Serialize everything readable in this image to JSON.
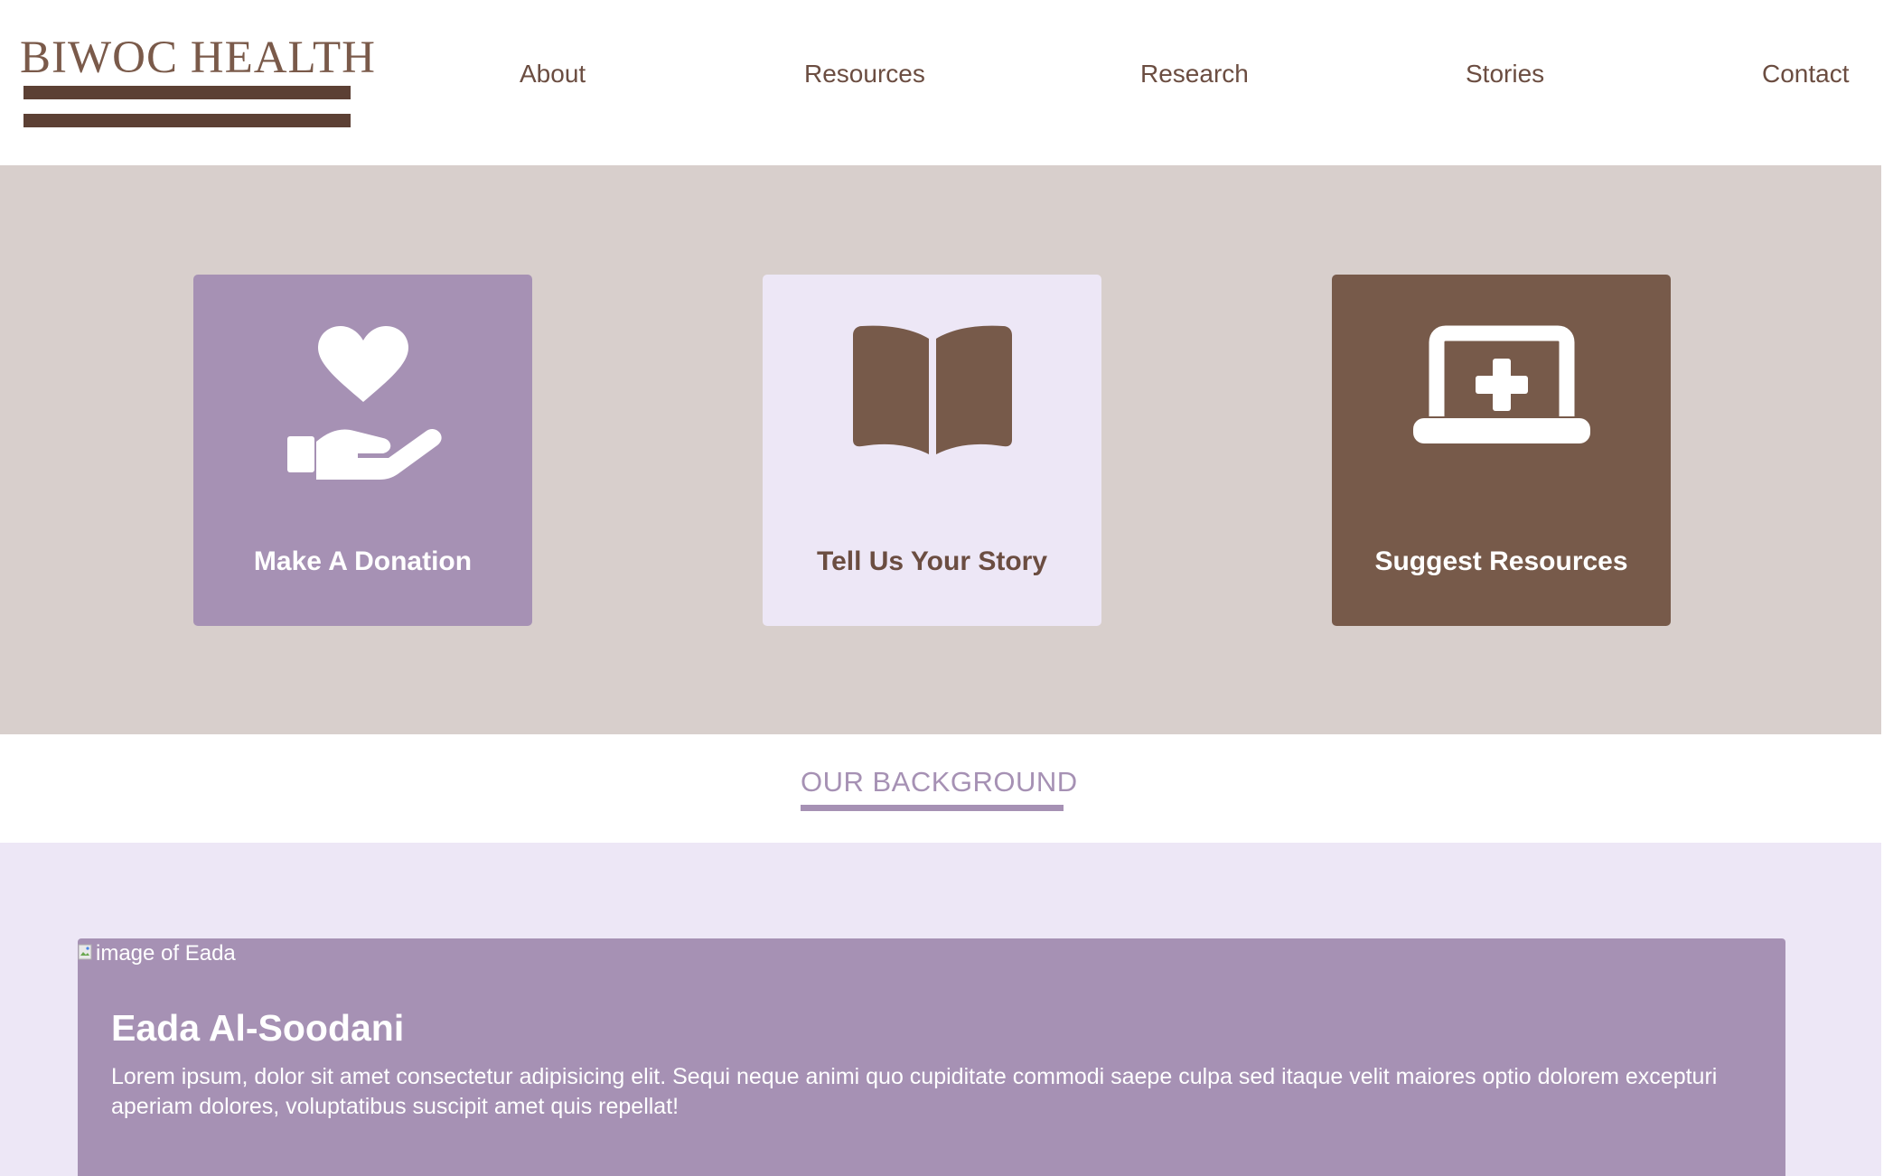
{
  "brand": {
    "name": "BIWOC HEALTH"
  },
  "nav": {
    "items": [
      {
        "label": "About"
      },
      {
        "label": "Resources"
      },
      {
        "label": "Research"
      },
      {
        "label": "Stories"
      },
      {
        "label": "Contact"
      }
    ]
  },
  "actions": {
    "cards": [
      {
        "label": "Make A Donation",
        "icon": "hand-heart-icon"
      },
      {
        "label": "Tell Us Your Story",
        "icon": "open-book-icon"
      },
      {
        "label": "Suggest Resources",
        "icon": "laptop-medical-icon"
      }
    ]
  },
  "background_section": {
    "title": "OUR BACKGROUND",
    "profile": {
      "image_alt": "image of Eada",
      "name": "Eada Al-Soodani",
      "bio": "Lorem ipsum, dolor sit amet consectetur adipisicing elit. Sequi neque animi quo cupiditate commodi saepe culpa sed itaque velit maiores optio dolorem excepturi aperiam dolores, voluptatibus suscipit amet quis repellat!"
    }
  },
  "colors": {
    "brand_brown": "#775a4a",
    "dark_brown": "#5c4034",
    "lavender": "#a691b4",
    "light_lavender": "#ede7f6",
    "taupe": "#d8cfcc"
  }
}
